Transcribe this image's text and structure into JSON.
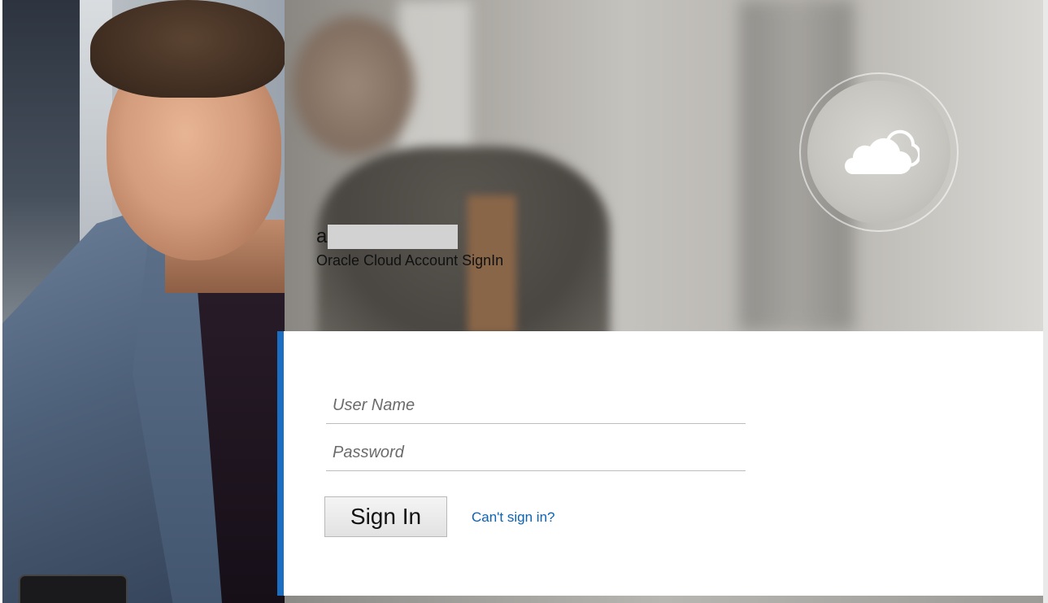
{
  "header": {
    "account_initial": "a",
    "subtitle": "Oracle Cloud Account SignIn"
  },
  "branding": {
    "badge_icon": "cloud-icon"
  },
  "form": {
    "username_placeholder": "User Name",
    "password_placeholder": "Password",
    "signin_label": "Sign In",
    "help_link": "Can't sign in?"
  },
  "colors": {
    "accent": "#1b6ec2",
    "link": "#0b63b6"
  }
}
